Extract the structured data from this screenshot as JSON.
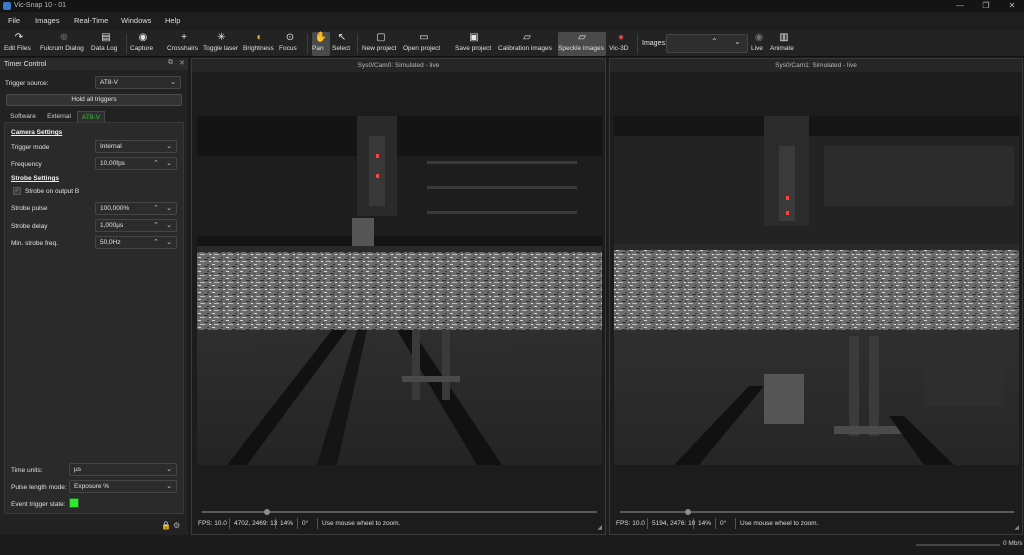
{
  "window": {
    "title": "Vic-Snap 10 - 01",
    "controls": [
      "—",
      "❐",
      "✕"
    ]
  },
  "menu": [
    "File",
    "Images",
    "Real-Time",
    "Windows",
    "Help"
  ],
  "toolbar": {
    "buttons": [
      {
        "label": "Edit Files",
        "icon": "↷",
        "icon_name": "edit-files-icon",
        "state": "normal"
      },
      {
        "label": "Fulcrum Dialog",
        "icon": "⊕",
        "icon_name": "fulcrum-icon",
        "state": "disabled"
      },
      {
        "label": "Data Log",
        "icon": "▤",
        "icon_name": "data-log-icon",
        "state": "normal"
      },
      {
        "label": "Capture",
        "icon": "◉",
        "icon_name": "camera-icon",
        "state": "normal"
      },
      {
        "label": "Crosshairs",
        "icon": "+",
        "icon_name": "crosshairs-icon",
        "state": "normal"
      },
      {
        "label": "Toggle laser",
        "icon": "✳",
        "icon_name": "laser-icon",
        "state": "normal"
      },
      {
        "label": "Brightness",
        "icon": "◐",
        "icon_name": "brightness-icon",
        "state": "normal"
      },
      {
        "label": "Focus",
        "icon": "⊙",
        "icon_name": "focus-icon",
        "state": "normal"
      },
      {
        "label": "Pan",
        "icon": "✋",
        "icon_name": "pan-hand-icon",
        "state": "active"
      },
      {
        "label": "Select",
        "icon": "↖",
        "icon_name": "select-cursor-icon",
        "state": "normal"
      },
      {
        "label": "New project",
        "icon": "▢",
        "icon_name": "new-project-icon",
        "state": "normal"
      },
      {
        "label": "Open project",
        "icon": "▭",
        "icon_name": "open-project-icon",
        "state": "normal"
      },
      {
        "label": "Save project",
        "icon": "▣",
        "icon_name": "save-icon",
        "state": "normal"
      },
      {
        "label": "Calibration images",
        "icon": "▱",
        "icon_name": "calibration-folder-icon",
        "state": "normal"
      },
      {
        "label": "Speckle images",
        "icon": "▱",
        "icon_name": "speckle-folder-icon",
        "state": "active"
      },
      {
        "label": "Vic-3D",
        "icon": "●",
        "icon_name": "vic3d-icon",
        "state": "normal"
      },
      {
        "label": "Live",
        "icon": "◉",
        "icon_name": "live-camera-icon",
        "state": "disabled"
      },
      {
        "label": "Animate",
        "icon": "▥",
        "icon_name": "animate-film-icon",
        "state": "normal"
      }
    ],
    "images_label": "Images:"
  },
  "timer_panel": {
    "title": "Timer Control",
    "trigger_source_label": "Trigger source:",
    "trigger_source_value": "AT8-V",
    "hold_all_label": "Hold all triggers",
    "tabs": [
      "Software",
      "External",
      "AT8-V"
    ],
    "camera_settings": "Camera Settings",
    "trigger_mode_label": "Trigger mode",
    "trigger_mode_value": "Internal",
    "frequency_label": "Frequency",
    "frequency_value": "10,00fps",
    "strobe_settings": "Strobe Settings",
    "strobe_on_output_label": "Strobe on output B",
    "strobe_pulse_label": "Strobe pulse",
    "strobe_pulse_value": "100,000%",
    "strobe_delay_label": "Strobe delay",
    "strobe_delay_value": "1,000µs",
    "min_strobe_label": "Min. strobe freq.",
    "min_strobe_value": "50,0Hz",
    "time_units_label": "Time units:",
    "time_units_value": "µs",
    "pulse_length_label": "Pulse length mode:",
    "pulse_length_value": "Exposure %",
    "event_trigger_label": "Event trigger state:",
    "event_trigger_color": "#2ee82e"
  },
  "cameras": [
    {
      "title": "Sys0/Cam0: Simulated - live",
      "status": [
        "FPS: 10.0",
        "4702, 2469: 13",
        "14%",
        "0°",
        "Use mouse wheel to zoom."
      ]
    },
    {
      "title": "Sys0/Cam1: Simulated - live",
      "status": [
        "FPS: 10.0",
        "5194, 2476: 10",
        "14%",
        "0°",
        "Use mouse wheel to zoom."
      ]
    }
  ],
  "bandwidth": "0 Mb/s"
}
